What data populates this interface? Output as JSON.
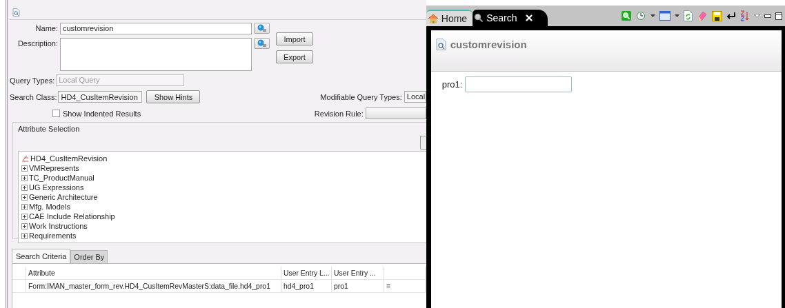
{
  "query_form": {
    "name_label": "Name:",
    "name_value": "customrevision",
    "description_label": "Description:",
    "buttons": [
      "Import",
      "Export"
    ],
    "query_types_label": "Query Types:",
    "query_types_value": "Local Query",
    "search_class_label": "Search Class:",
    "search_class_value": "HD4_CusItemRevision",
    "show_hints_button": "Show Hints",
    "modifiable_label": "Modifiable Query Types:",
    "modifiable_value": "Local",
    "show_indented": {
      "label": "Show Indented Results",
      "checked": false
    },
    "revision_rule_label": "Revision Rule:"
  },
  "attribute_selection": {
    "title": "Attribute Selection",
    "tree": [
      {
        "label": "HD4_CusItemRevision",
        "kind": "class"
      },
      {
        "label": "VMRepresents",
        "kind": "relation",
        "expanded": false
      },
      {
        "label": "TC_ProductManual",
        "kind": "relation",
        "expanded": false
      },
      {
        "label": "UG Expressions",
        "kind": "relation",
        "expanded": false
      },
      {
        "label": "Generic Architecture",
        "kind": "relation",
        "expanded": false
      },
      {
        "label": "Mfg. Models",
        "kind": "relation",
        "expanded": false
      },
      {
        "label": "CAE Include Relationship",
        "kind": "relation",
        "expanded": false
      },
      {
        "label": "Work Instructions",
        "kind": "relation",
        "expanded": false
      },
      {
        "label": "Requirements",
        "kind": "relation",
        "expanded": false
      }
    ]
  },
  "criteria_tabs": [
    {
      "label": "Search Criteria",
      "selected": true
    },
    {
      "label": "Order By",
      "selected": false
    }
  ],
  "criteria_table": {
    "columns": [
      "Attribute",
      "User Entry L...",
      "User Entry ..."
    ],
    "rows": [
      [
        "Form:IMAN_master_form_rev.HD4_CusItemRevMasterS:data_file.hd4_pro1",
        "hd4_pro1",
        "pro1",
        "="
      ]
    ]
  },
  "view_tabs": [
    {
      "label": "Home",
      "kind": "home",
      "selected": false
    },
    {
      "label": "Search",
      "kind": "search",
      "selected": true
    }
  ],
  "search_view": {
    "title": "customrevision",
    "fields": [
      {
        "label": "pro1:"
      }
    ]
  }
}
